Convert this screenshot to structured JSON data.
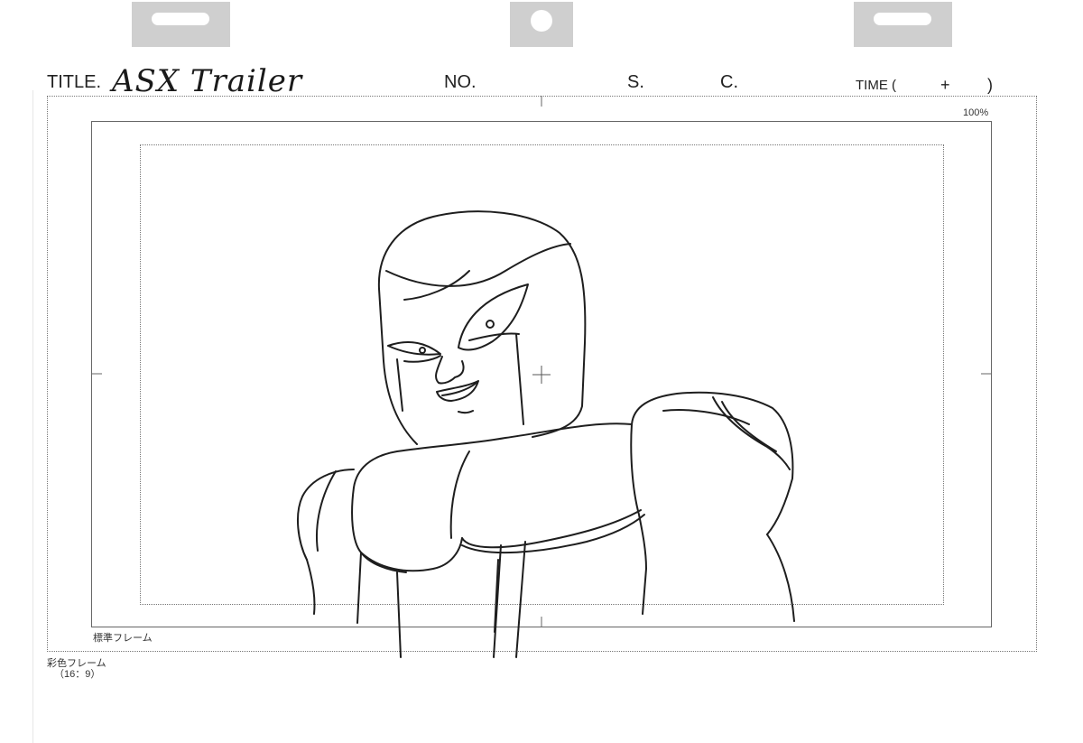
{
  "sheet": {
    "title_label": "TITLE.",
    "title_value": "ASX Trailer",
    "no_label": "NO.",
    "s_label": "S.",
    "c_label": "C.",
    "time_open": "TIME (",
    "time_plus": "+",
    "time_close": ")",
    "zoom": "100%",
    "standard_frame_label": "標準フレーム",
    "color_frame_label": "彩色フレーム",
    "color_frame_ratio": "（16：9）"
  },
  "colors": {
    "line": "#222222",
    "peg": "#cfcfcf",
    "frame": "#666666"
  }
}
